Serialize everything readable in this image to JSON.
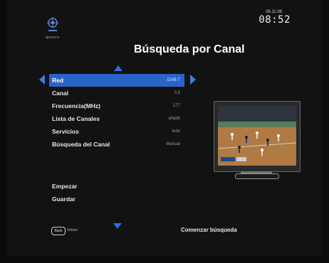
{
  "header": {
    "logo_text": "ipsvers",
    "date": "06.11.08",
    "time": "08:52",
    "title": "Búsqueda por Canal"
  },
  "menu": {
    "items": [
      {
        "label": "Red",
        "value": "DVB-T",
        "selected": true
      },
      {
        "label": "Canal",
        "value": "0.5"
      },
      {
        "label": "Frecuencia(MHz)",
        "value": "177"
      },
      {
        "label": "Lista de Canales",
        "value": "añadir"
      },
      {
        "label": "Servicios",
        "value": "todo"
      },
      {
        "label": "Búsqueda del Canal",
        "value": "Manual"
      }
    ],
    "actions": [
      "Empezar",
      "Guardar"
    ]
  },
  "footer": {
    "back_key": "Back",
    "back_label": "Volver",
    "hint": "Comenzar búsqueda"
  },
  "colors": {
    "accent": "#2a64c8",
    "background": "#121212"
  }
}
